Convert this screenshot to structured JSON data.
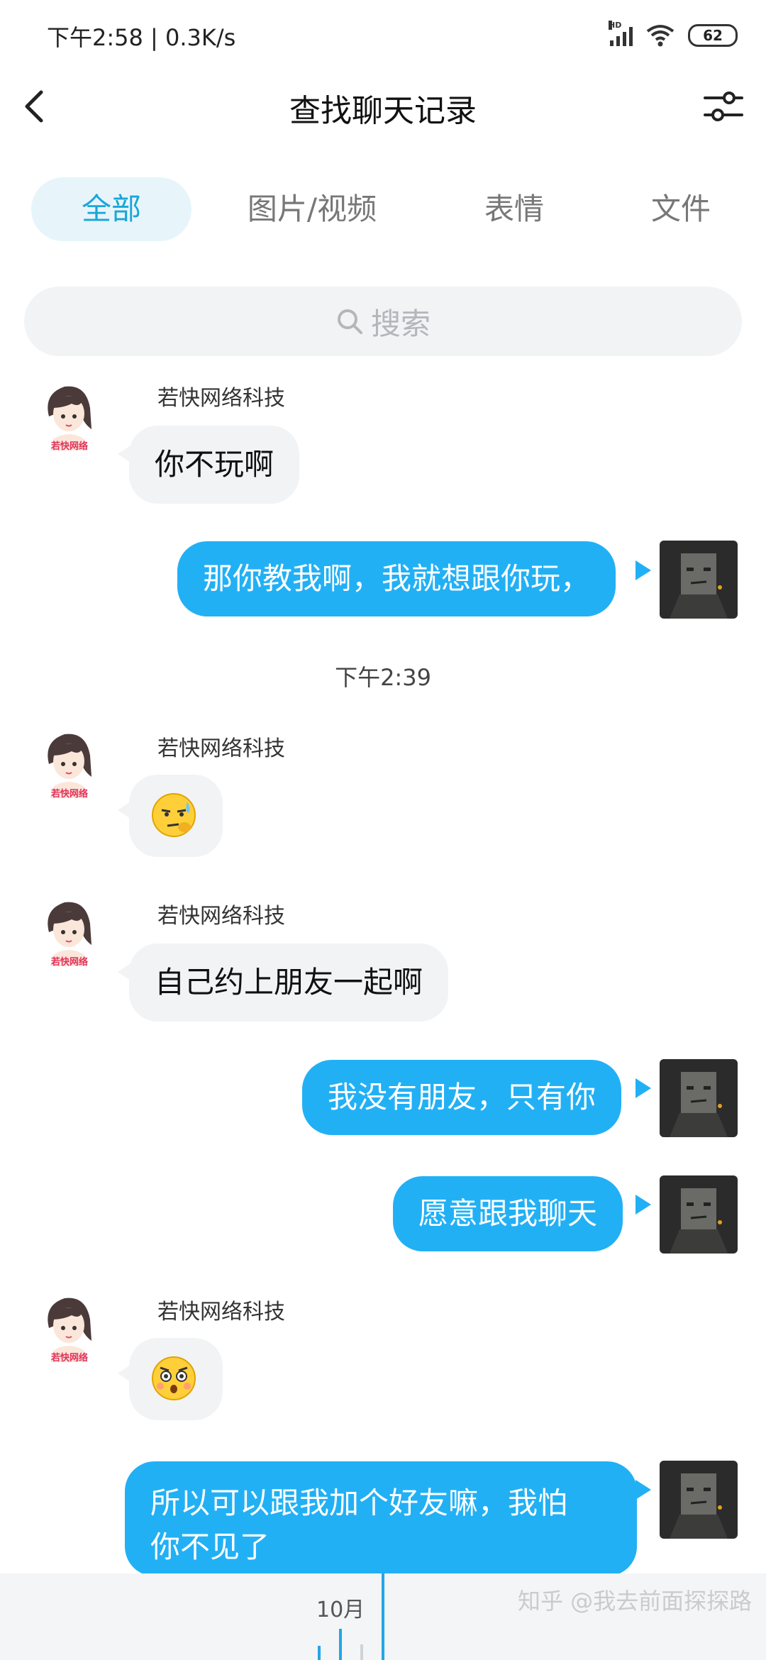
{
  "status_bar": {
    "text": "下午2:58 | 0.3K/s",
    "battery": "62",
    "network_badge": "HD"
  },
  "header": {
    "title": "查找聊天记录"
  },
  "tabs": [
    {
      "label": "全部",
      "active": true
    },
    {
      "label": "图片/视频",
      "active": false
    },
    {
      "label": "表情",
      "active": false
    },
    {
      "label": "文件",
      "active": false
    }
  ],
  "search": {
    "placeholder": "搜索"
  },
  "messages": [
    {
      "side": "left",
      "sender": "若快网络科技",
      "text": "你不玩啊"
    },
    {
      "side": "right",
      "text": "那你教我啊，我就想跟你玩，"
    },
    {
      "type": "timestamp",
      "text": "下午2:39"
    },
    {
      "side": "left",
      "sender": "若快网络科技",
      "emoji": "sweat-emoji"
    },
    {
      "side": "left",
      "sender": "若快网络科技",
      "text": "自己约上朋友一起啊"
    },
    {
      "side": "right",
      "text": "我没有朋友，只有你"
    },
    {
      "side": "right",
      "text": "愿意跟我聊天"
    },
    {
      "side": "left",
      "sender": "若快网络科技",
      "emoji": "shocked-emoji"
    },
    {
      "side": "right",
      "lines": [
        "所以可以跟我加个好友嘛，我怕",
        "你不见了"
      ]
    }
  ],
  "avatar_caption": "若快网络",
  "timeline": {
    "month": "10月"
  },
  "watermark": "知乎 @我去前面探探路",
  "colors": {
    "accent": "#22b0f5",
    "tab_active_bg": "#e7f5fb",
    "bubble_left": "#f2f3f5"
  }
}
